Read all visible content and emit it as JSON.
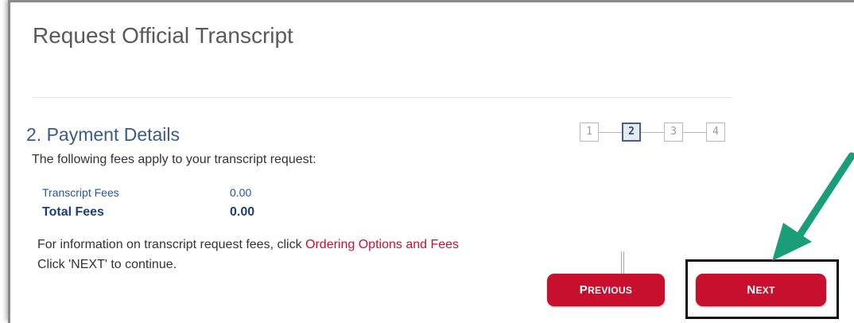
{
  "page": {
    "title": "Request Official Transcript"
  },
  "section": {
    "title": "2. Payment Details",
    "intro": "The following fees apply to your transcript request:"
  },
  "fees": {
    "items": [
      {
        "label": "Transcript Fees",
        "value": "0.00"
      }
    ],
    "total_label": "Total Fees",
    "total_value": "0.00"
  },
  "info": {
    "prefix": "For information on transcript request fees, click ",
    "link_text": "Ordering Options and Fees",
    "continue_text": "Click 'NEXT' to continue."
  },
  "steps": {
    "items": [
      "1",
      "2",
      "3",
      "4"
    ],
    "current": 2
  },
  "buttons": {
    "previous": {
      "first": "P",
      "rest": "REVIOUS"
    },
    "next": {
      "first": "N",
      "rest": "EXT"
    }
  },
  "colors": {
    "accent_red": "#c8102e",
    "title_blue": "#3a5a8c",
    "arrow_green": "#1a9e7a"
  },
  "annotation": {
    "arrow_icon": "green-arrow-icon",
    "highlight": "next-button-highlight-box"
  }
}
